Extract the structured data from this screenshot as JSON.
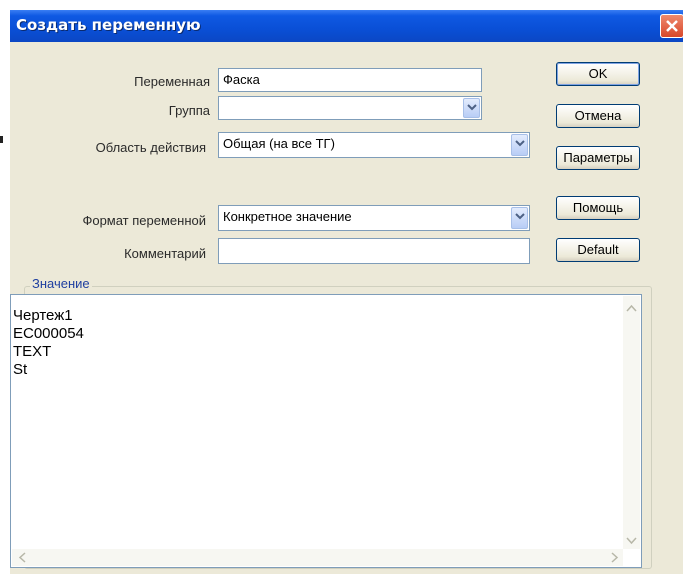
{
  "window": {
    "title": "Создать переменную"
  },
  "form": {
    "variable_label": "Переменная",
    "variable_value": "Фаска",
    "group_label": "Группа",
    "group_value": "",
    "scope_label": "Область действия",
    "scope_value": "Общая (на все ТГ)",
    "format_label": "Формат переменной",
    "format_value": "Конкретное значение",
    "comment_label": "Комментарий",
    "comment_value": ""
  },
  "buttons": {
    "ok": "OK",
    "cancel": "Отмена",
    "parameters": "Параметры",
    "help": "Помощь",
    "default": "Default"
  },
  "value_group": {
    "label": "Значение",
    "lines": [
      "Чертеж1",
      "EC000054",
      "TEXT",
      "St"
    ]
  },
  "colors": {
    "titlebar": "#0a4fd6",
    "dialog_bg": "#ece9d8",
    "field_border": "#7f9db9",
    "close_button": "#d8472a"
  }
}
